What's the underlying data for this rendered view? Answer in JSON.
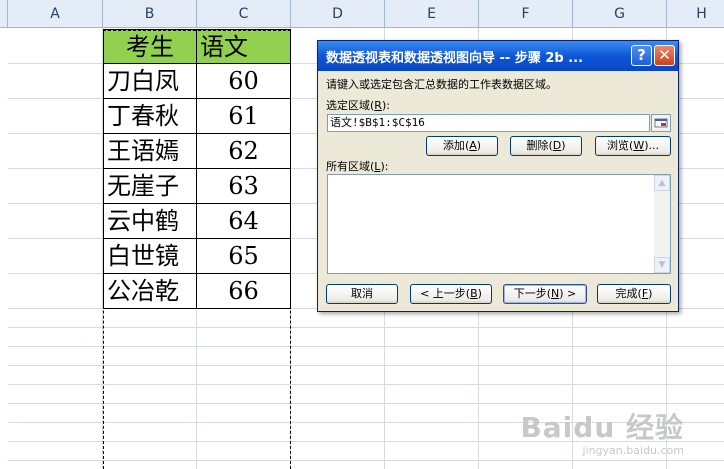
{
  "spreadsheet": {
    "columns": [
      "A",
      "B",
      "C",
      "D",
      "E",
      "F",
      "G",
      "H"
    ],
    "header_row": [
      "考生",
      "语文"
    ],
    "rows": [
      {
        "name": "刀白凤",
        "score": "60"
      },
      {
        "name": "丁春秋",
        "score": "61"
      },
      {
        "name": "王语嫣",
        "score": "62"
      },
      {
        "name": "无崖子",
        "score": "63"
      },
      {
        "name": "云中鹤",
        "score": "64"
      },
      {
        "name": "白世镜",
        "score": "65"
      },
      {
        "name": "公冶乾",
        "score": "66"
      }
    ],
    "header_fill_color": "#92d050"
  },
  "dialog": {
    "title": "数据透视表和数据透视图向导 -- 步骤 2b ...",
    "instruction": "请键入或选定包含汇总数据的工作表数据区域。",
    "range_label": "选定区域",
    "range_key": "R",
    "range_value": "语文!$B$1:$C$16",
    "add_label": "添加",
    "add_key": "A",
    "delete_label": "删除",
    "delete_key": "D",
    "browse_label": "浏览",
    "browse_key": "W",
    "all_ranges_label": "所有区域",
    "all_ranges_key": "L",
    "cancel_label": "取消",
    "back_label": "上一步",
    "back_key": "B",
    "next_label": "下一步",
    "next_key": "N",
    "finish_label": "完成",
    "finish_key": "F",
    "help_glyph": "?",
    "close_glyph": "✕",
    "icons": [
      "help-icon",
      "close-icon",
      "collapse-dialog-icon",
      "scroll-up-icon",
      "scroll-down-icon"
    ]
  },
  "watermark": {
    "main": "Baidu 经验",
    "sub": "jingyan.baidu.com"
  }
}
